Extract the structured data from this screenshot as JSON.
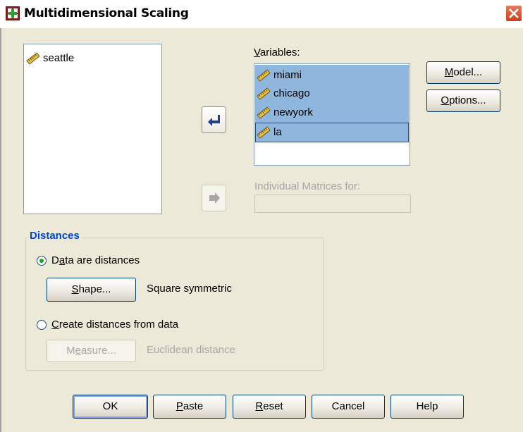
{
  "window": {
    "title": "Multidimensional Scaling"
  },
  "source_list": {
    "items": [
      {
        "label": "seattle",
        "icon": "ruler-icon"
      }
    ]
  },
  "variables": {
    "label_pre": "",
    "label_key": "V",
    "label_post": "ariables:",
    "items": [
      {
        "label": "miami",
        "icon": "ruler-icon"
      },
      {
        "label": "chicago",
        "icon": "ruler-icon"
      },
      {
        "label": "newyork",
        "icon": "ruler-icon"
      },
      {
        "label": "la",
        "icon": "ruler-icon"
      }
    ]
  },
  "individual_matrices": {
    "label": "Individual Matrices for:",
    "value": ""
  },
  "side_buttons": {
    "model": {
      "key": "M",
      "rest": "odel..."
    },
    "options": {
      "key": "O",
      "rest": "ptions..."
    }
  },
  "distances": {
    "title": "Distances",
    "data_are_distances": {
      "pre": "D",
      "key": "a",
      "post": "ta are distances",
      "selected": true
    },
    "shape_button": {
      "key": "S",
      "rest": "hape..."
    },
    "shape_value": "Square symmetric",
    "create_distances": {
      "key": "C",
      "post": "reate distances from data",
      "selected": false
    },
    "measure_button": {
      "pre": "M",
      "key": "e",
      "rest": "asure..."
    },
    "measure_value": "Euclidean distance"
  },
  "bottom_buttons": {
    "ok": "OK",
    "paste": {
      "key": "P",
      "rest": "aste"
    },
    "reset": {
      "key": "R",
      "rest": "eset"
    },
    "cancel": "Cancel",
    "help": "Help"
  },
  "colors": {
    "selection": "#8fb6dc",
    "group_title": "#0046d5",
    "close_button": "#c73e1d"
  }
}
